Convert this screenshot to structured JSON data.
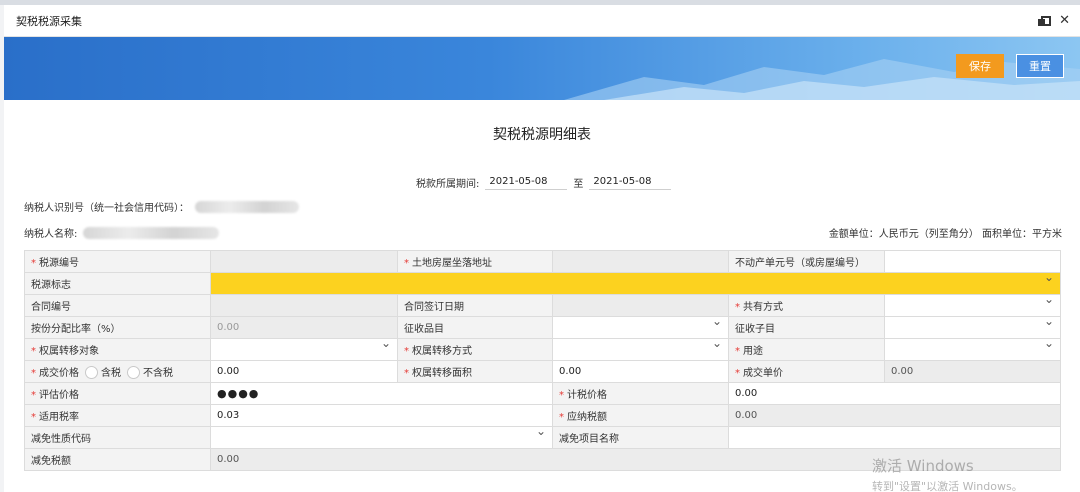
{
  "window": {
    "title": "契税税源采集"
  },
  "toolbar": {
    "save_label": "保存",
    "reset_label": "重置"
  },
  "form": {
    "title": "契税税源明细表",
    "period_label": "税款所属期间:",
    "period_from": "2021-05-08",
    "period_to_sep": "至",
    "period_to": "2021-05-08",
    "taxpayer_id_label": "纳税人识别号（统一社会信用代码）：",
    "taxpayer_name_label": "纳税人名称:",
    "units_text": "金额单位：人民币元（列至角分） 面积单位：平方米"
  },
  "fields": {
    "tax_source_no": "税源编号",
    "land_address": "土地房屋坐落地址",
    "real_estate_unit_no": "不动产单元号（或房屋编号）",
    "tax_source_flag": "税源标志",
    "contract_no": "合同编号",
    "contract_sign_date": "合同签订日期",
    "co_ownership": "共有方式",
    "share_ratio": "按份分配比率（%）",
    "share_ratio_value": "0.00",
    "levy_item": "征收品目",
    "levy_subitem": "征收子目",
    "transfer_object": "权属转移对象",
    "transfer_method": "权属转移方式",
    "usage": "用途",
    "deal_price": "成交价格",
    "tax_included": "含税",
    "tax_excluded": "不含税",
    "deal_price_value": "0.00",
    "transfer_area": "权属转移面积",
    "transfer_area_value": "0.00",
    "unit_price": "成交单价",
    "unit_price_value": "0.00",
    "appraisal_price": "评估价格",
    "appraisal_price_value": "●●●●",
    "tax_base_price": "计税价格",
    "tax_base_price_value": "0.00",
    "tax_rate": "适用税率",
    "tax_rate_value": "0.03",
    "tax_payable": "应纳税额",
    "tax_payable_value": "0.00",
    "exemption_code": "减免性质代码",
    "exemption_item_name": "减免项目名称",
    "exemption_amount": "减免税额",
    "exemption_amount_value": "0.00"
  },
  "watermark": {
    "line1": "激活 Windows",
    "line2": "转到\"设置\"以激活 Windows。"
  },
  "colors": {
    "save": "#f39a1e",
    "reset": "#4a90e2",
    "flag_bg": "#fcd21f",
    "required": "#e53935"
  }
}
